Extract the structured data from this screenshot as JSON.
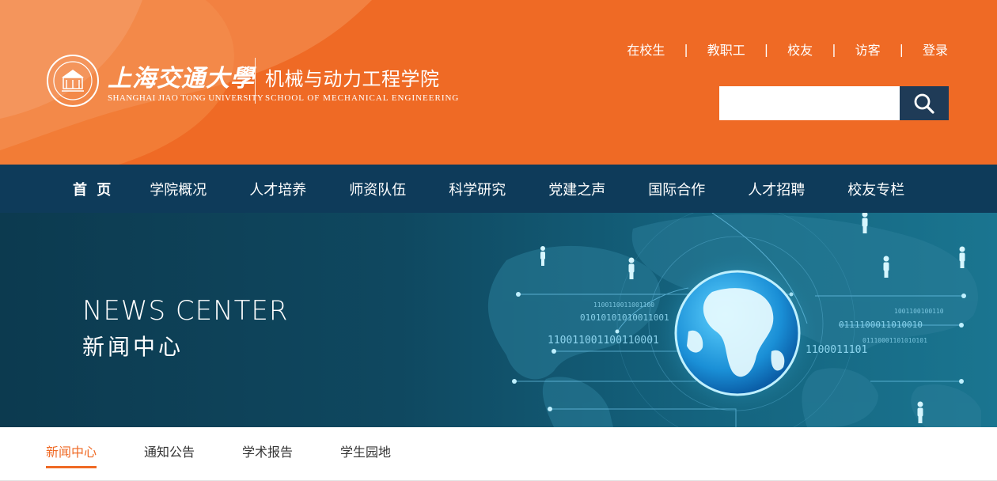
{
  "header": {
    "university_cn": "上海交通大學",
    "university_en": "SHANGHAI JIAO TONG UNIVERSITY",
    "school_cn": "机械与动力工程学院",
    "school_en": "SCHOOL OF MECHANICAL ENGINEERING",
    "top_links": [
      "在校生",
      "教职工",
      "校友",
      "访客",
      "登录"
    ],
    "search": {
      "placeholder": "",
      "value": ""
    },
    "colors": {
      "brand": "#ef6a25",
      "search_button": "#1f3b57"
    }
  },
  "nav": {
    "items": [
      "首 页",
      "学院概况",
      "人才培养",
      "师资队伍",
      "科学研究",
      "党建之声",
      "国际合作",
      "人才招聘",
      "校友专栏"
    ],
    "active_index": 0,
    "color": "#0e3b5a"
  },
  "banner": {
    "title_en": "NEWS CENTER",
    "title_cn": "新闻中心",
    "binary_text": [
      "1100110011001100",
      "01010101010011001",
      "110011001100110001",
      "0111100011010010",
      "1100011101",
      "01110001101010101",
      "1001100100110"
    ]
  },
  "tabs": {
    "items": [
      "新闻中心",
      "通知公告",
      "学术报告",
      "学生园地"
    ],
    "active_index": 0,
    "accent": "#ef6a25"
  }
}
